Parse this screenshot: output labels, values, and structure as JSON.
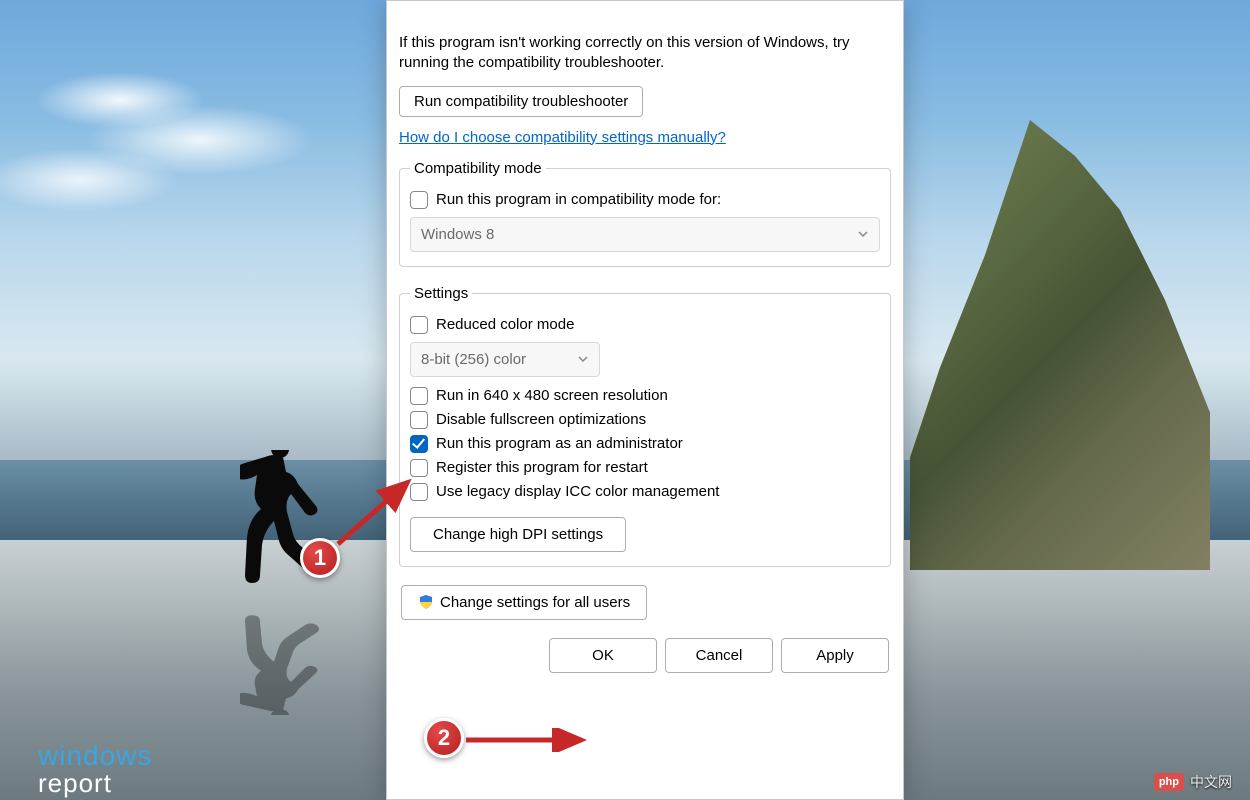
{
  "dialog": {
    "description": "If this program isn't working correctly on this version of Windows, try running the compatibility troubleshooter.",
    "run_troubleshooter_btn": "Run compatibility troubleshooter",
    "help_link": "How do I choose compatibility settings manually?",
    "compat_mode": {
      "legend": "Compatibility mode",
      "checkbox_label": "Run this program in compatibility mode for:",
      "checkbox_checked": false,
      "dropdown_value": "Windows 8"
    },
    "settings": {
      "legend": "Settings",
      "reduced_color": {
        "label": "Reduced color mode",
        "checked": false
      },
      "color_dropdown": "8-bit (256) color",
      "run_640": {
        "label": "Run in 640 x 480 screen resolution",
        "checked": false
      },
      "disable_fullscreen": {
        "label": "Disable fullscreen optimizations",
        "checked": false
      },
      "run_admin": {
        "label": "Run this program as an administrator",
        "checked": true
      },
      "register_restart": {
        "label": "Register this program for restart",
        "checked": false
      },
      "legacy_icc": {
        "label": "Use legacy display ICC color management",
        "checked": false
      },
      "dpi_btn": "Change high DPI settings"
    },
    "all_users_btn": "Change settings for all users",
    "footer": {
      "ok": "OK",
      "cancel": "Cancel",
      "apply": "Apply"
    }
  },
  "annotations": {
    "marker1": "1",
    "marker2": "2"
  },
  "watermarks": {
    "wr_line1": "windows",
    "wr_line2": "report",
    "php_badge": "php",
    "php_text": "中文网"
  }
}
